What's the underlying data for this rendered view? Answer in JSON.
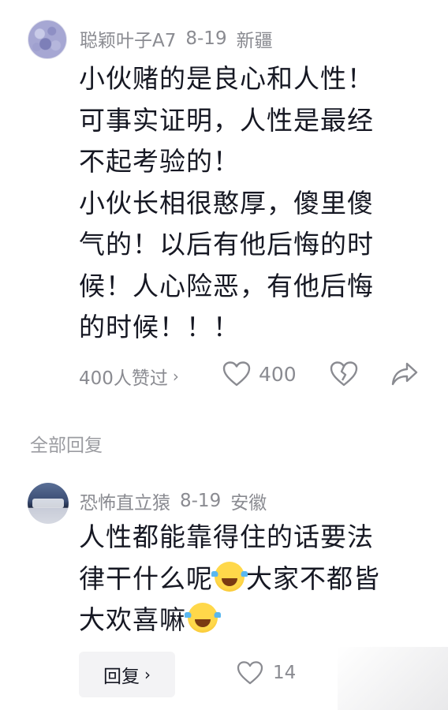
{
  "comment": {
    "username": "聪颖叶子A7",
    "date": "8-19",
    "location": "新疆",
    "lines": [
      "小伙赌的是良心和人性！",
      "可事实证明，人性是最经",
      "不起考验的！",
      "小伙长相很憨厚，傻里傻",
      "气的！以后有他后悔的时",
      "候！人心险恶，有他后悔",
      "的时候！！！"
    ],
    "likes_summary": "400人赞过",
    "like_count": "400",
    "chevron": "›"
  },
  "section_label": "全部回复",
  "reply": {
    "username": "恐怖直立猿",
    "date": "8-19",
    "location": "安徽",
    "line1": "人性都能靠得住的话要法",
    "line2_a": "律干什么呢",
    "line2_b": "大家不都皆",
    "line3": "大欢喜嘛",
    "emoji_name": "laugh-cry-emoji",
    "reply_label": "回复",
    "like_count": "14"
  },
  "icons": {
    "heart": "heart-icon",
    "dislike": "broken-heart-icon",
    "share": "share-icon",
    "chevron": "chevron-right-icon"
  },
  "colors": {
    "text_primary": "#161823",
    "text_secondary": "#8a8b91",
    "button_bg": "#f3f3f5"
  }
}
